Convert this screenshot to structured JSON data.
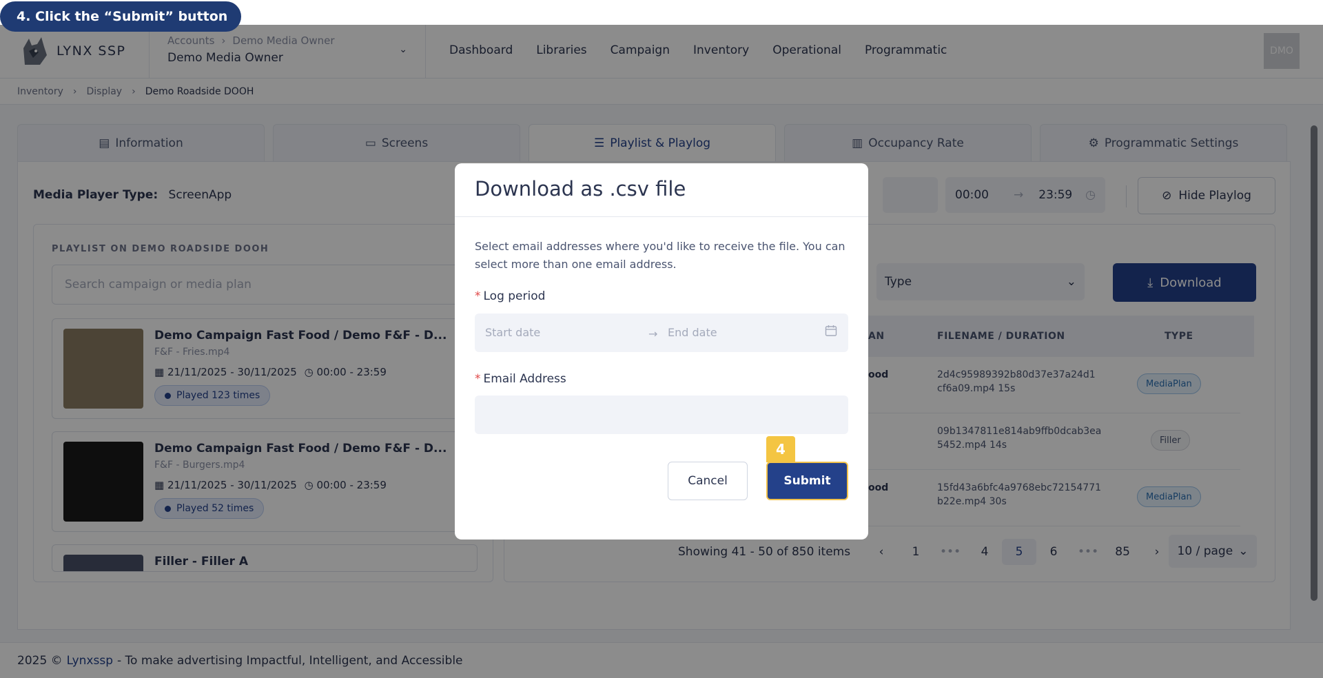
{
  "instruction": {
    "text": "4. Click the “Submit” button"
  },
  "header": {
    "logo_text": "LYNX SSP",
    "account_crumb": [
      "Accounts",
      "Demo Media Owner"
    ],
    "account_name": "Demo Media Owner",
    "nav": [
      "Dashboard",
      "Libraries",
      "Campaign",
      "Inventory",
      "Operational",
      "Programmatic"
    ],
    "avatar_initials": "DMO"
  },
  "breadcrumb": [
    "Inventory",
    "Display",
    "Demo Roadside DOOH"
  ],
  "tabs": [
    {
      "label": "Information",
      "icon": "clipboard-icon"
    },
    {
      "label": "Screens",
      "icon": "monitor-icon"
    },
    {
      "label": "Playlist & Playlog",
      "icon": "list-icon",
      "active": true
    },
    {
      "label": "Occupancy Rate",
      "icon": "bar-chart-icon"
    },
    {
      "label": "Programmatic Settings",
      "icon": "settings-icon"
    }
  ],
  "panel": {
    "media_player_label": "Media Player Type:",
    "media_player_value": "ScreenApp",
    "time_start": "00:00",
    "time_end": "23:59",
    "hide_playlog_label": "Hide Playlog"
  },
  "playlist": {
    "title": "PLAYLIST ON DEMO ROADSIDE DOOH",
    "search_placeholder": "Search campaign or media plan",
    "items": [
      {
        "title": "Demo Campaign Fast Food / Demo F&F - D...",
        "file": "F&F - Fries.mp4",
        "dates": "21/11/2025 - 30/11/2025",
        "time": "00:00 - 23:59",
        "played": "Played 123 times"
      },
      {
        "title": "Demo Campaign Fast Food / Demo F&F - D...",
        "file": "F&F - Burgers.mp4",
        "dates": "21/11/2025 - 30/11/2025",
        "time": "00:00 - 23:59",
        "played": "Played 52 times"
      },
      {
        "title": "Filler - Filler A"
      }
    ]
  },
  "playlog": {
    "type_placeholder": "Type",
    "download_label": "Download",
    "columns": [
      "AN",
      "FILENAME / DURATION",
      "TYPE"
    ],
    "rows": [
      {
        "frag": "ood",
        "filename": "2d4c95989392b80d37e37a24d1 cf6a09.mp4 15s",
        "type": "MediaPlan"
      },
      {
        "frag": "",
        "filename": "09b1347811e814ab9ffb0dcab3ea 5452.mp4 14s",
        "type": "Filler"
      },
      {
        "frag": "ood",
        "filename": "15fd43a6bfc4a9768ebc72154771 b22e.mp4 30s",
        "type": "MediaPlan"
      }
    ],
    "pagination": {
      "info": "Showing 41 - 50 of 850 items",
      "pages": [
        "1",
        "•••",
        "4",
        "5",
        "6",
        "•••",
        "85"
      ],
      "current": "5",
      "per_page": "10 / page"
    }
  },
  "footer": {
    "prefix": "2025 ©",
    "link": "Lynxssp",
    "suffix": "- To make advertising Impactful, Intelligent, and Accessible"
  },
  "modal": {
    "title": "Download as .csv file",
    "description": "Select email addresses where you'd like to receive the file. You can select more than one email address.",
    "log_period_label": "Log period",
    "start_placeholder": "Start date",
    "end_placeholder": "End date",
    "email_label": "Email Address",
    "cancel_label": "Cancel",
    "submit_label": "Submit",
    "step_number": "4",
    "required_mark": "*"
  },
  "colors": {
    "primary": "#24418a",
    "highlight": "#f4c542",
    "required": "#e04848"
  }
}
